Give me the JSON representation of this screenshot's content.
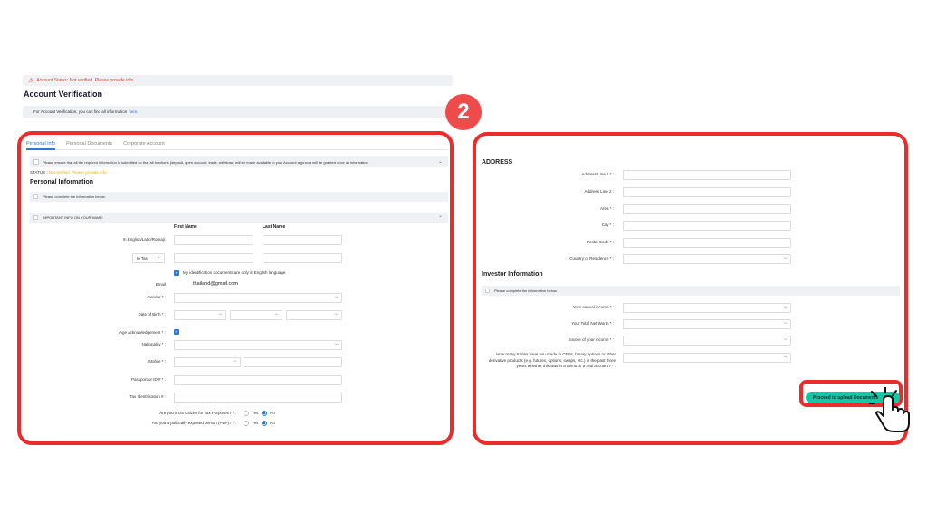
{
  "alert": {
    "text": "Account Status: Not verified. Please provide info.",
    "icon": "warning-icon"
  },
  "page_title": "Account Verification",
  "info_bar": {
    "text": "For Account Verification, you can find all information",
    "link": "here."
  },
  "step_number": "2",
  "tabs": [
    "Personal info",
    "Personal Documents",
    "Corporate Account"
  ],
  "notice": "Please ensure that all the required information is submitted so that all functions (deposit, open account, trade, withdraw) will be made available to you. Account approval will be granted once all information",
  "status": {
    "label": "STATUS :",
    "value": "Not verified. Please provide info."
  },
  "personal": {
    "title": "Personal Information",
    "subnote": "Please complete the information below.",
    "important_info": "IMPORTANT INFO ON YOUR NAME:",
    "first_name_head": "First Name",
    "last_name_head": "Last Name",
    "name_label": "In English/Latin/Romaji:",
    "title_select": "In Tasi",
    "english_check": "My identification documents are only in English language",
    "email_label": "Email",
    "email_value": "thailand@gmail.com",
    "gender_label": "Gender * :",
    "dob_label": "Date of Birth * :",
    "age_label": "Age acknowledgement * :",
    "nationality_label": "Nationality * :",
    "mobile_label": "Mobile * :",
    "passport_label": "Passport or ID # * :",
    "tax_label": "Tax Identification # :",
    "us_label": "Are you a US Citizen for Tax Purposes? * :",
    "pep_label": "Are you a politically exposed person (PEP)? * :",
    "yes": "Yes",
    "no": "No"
  },
  "address": {
    "title": "ADDRESS",
    "line1": "Address Line 1 * :",
    "line2": "Address Line 2 :",
    "area": "Area * :",
    "city": "City * :",
    "postal": "Postal Code * :",
    "country": "Country of Residence * :"
  },
  "investor": {
    "title": "Investor Information",
    "subnote": "Please complete the information below.",
    "income": "Your annual income * :",
    "networth": "Your Total Net Worth * :",
    "source": "Source of your income * :",
    "trades": "How many trades have you made in CFDs, binary options or other derivative products (e.g. futures, options, swaps, etc.) in the past three years whether this was in a demo or a real account? * :"
  },
  "proceed_button": "Proceed to upload Documents",
  "colors": {
    "accent": "#2a7bd8",
    "highlight": "#ec2b2b",
    "button": "#16c6a6",
    "status": "#e8b100"
  }
}
